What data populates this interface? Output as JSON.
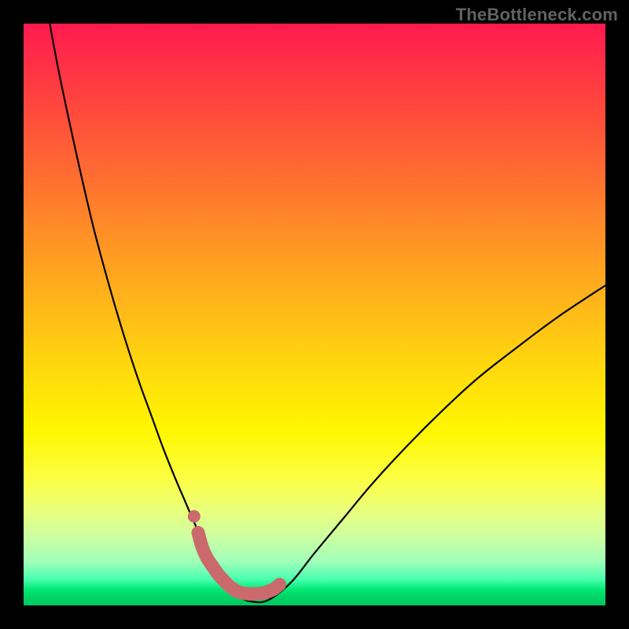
{
  "watermark": "TheBottleneck.com",
  "chart_data": {
    "type": "line",
    "title": "",
    "xlabel": "",
    "ylabel": "",
    "xlim": [
      0,
      100
    ],
    "ylim": [
      0,
      100
    ],
    "grid": false,
    "legend": false,
    "gradient_stops": [
      {
        "pos": 0,
        "color": "#ff1a4f"
      },
      {
        "pos": 12,
        "color": "#ff4040"
      },
      {
        "pos": 27,
        "color": "#ff7030"
      },
      {
        "pos": 42,
        "color": "#ffa320"
      },
      {
        "pos": 57,
        "color": "#ffd210"
      },
      {
        "pos": 70,
        "color": "#fff700"
      },
      {
        "pos": 79,
        "color": "#fbff4a"
      },
      {
        "pos": 84,
        "color": "#e7ff80"
      },
      {
        "pos": 88,
        "color": "#cfffa0"
      },
      {
        "pos": 92.5,
        "color": "#9fffb9"
      },
      {
        "pos": 95.5,
        "color": "#4affb0"
      },
      {
        "pos": 97.3,
        "color": "#00e874"
      },
      {
        "pos": 98.3,
        "color": "#00d868"
      },
      {
        "pos": 100,
        "color": "#00c85f"
      }
    ],
    "series": [
      {
        "name": "bottleneck-curve",
        "color": "#000000",
        "x": [
          4.5,
          6,
          8,
          10,
          12,
          14,
          16,
          18,
          20,
          22,
          24,
          26,
          27.5,
          29,
          30.5,
          32,
          33.5,
          35,
          37,
          39,
          42,
          46,
          50,
          55,
          60,
          66,
          72,
          78,
          85,
          92,
          100
        ],
        "y": [
          100,
          92,
          82.5,
          73.5,
          65,
          57.5,
          50.5,
          44,
          38,
          32.5,
          27,
          22,
          18.5,
          15,
          11.7,
          8.7,
          6,
          3.7,
          1.6,
          0.7,
          0.9,
          4,
          9,
          15,
          21,
          27.5,
          33.5,
          39,
          44.5,
          49.7,
          55
        ]
      }
    ],
    "highlight_band": {
      "name": "optimal-range",
      "color": "#cb6a6c",
      "x": [
        30.0,
        30.7,
        31.5,
        32.5,
        33.5,
        34.5,
        35.5,
        37.0,
        38.5,
        40.0,
        41.5,
        43.0,
        44.0
      ],
      "y": [
        12.5,
        10.0,
        8.2,
        6.7,
        5.3,
        4.2,
        3.2,
        2.3,
        2.0,
        2.0,
        2.2,
        2.8,
        3.6
      ]
    },
    "highlight_dot": {
      "name": "marker-dot",
      "color": "#cb6a6c",
      "x": 29.3,
      "y": 15.3
    }
  }
}
